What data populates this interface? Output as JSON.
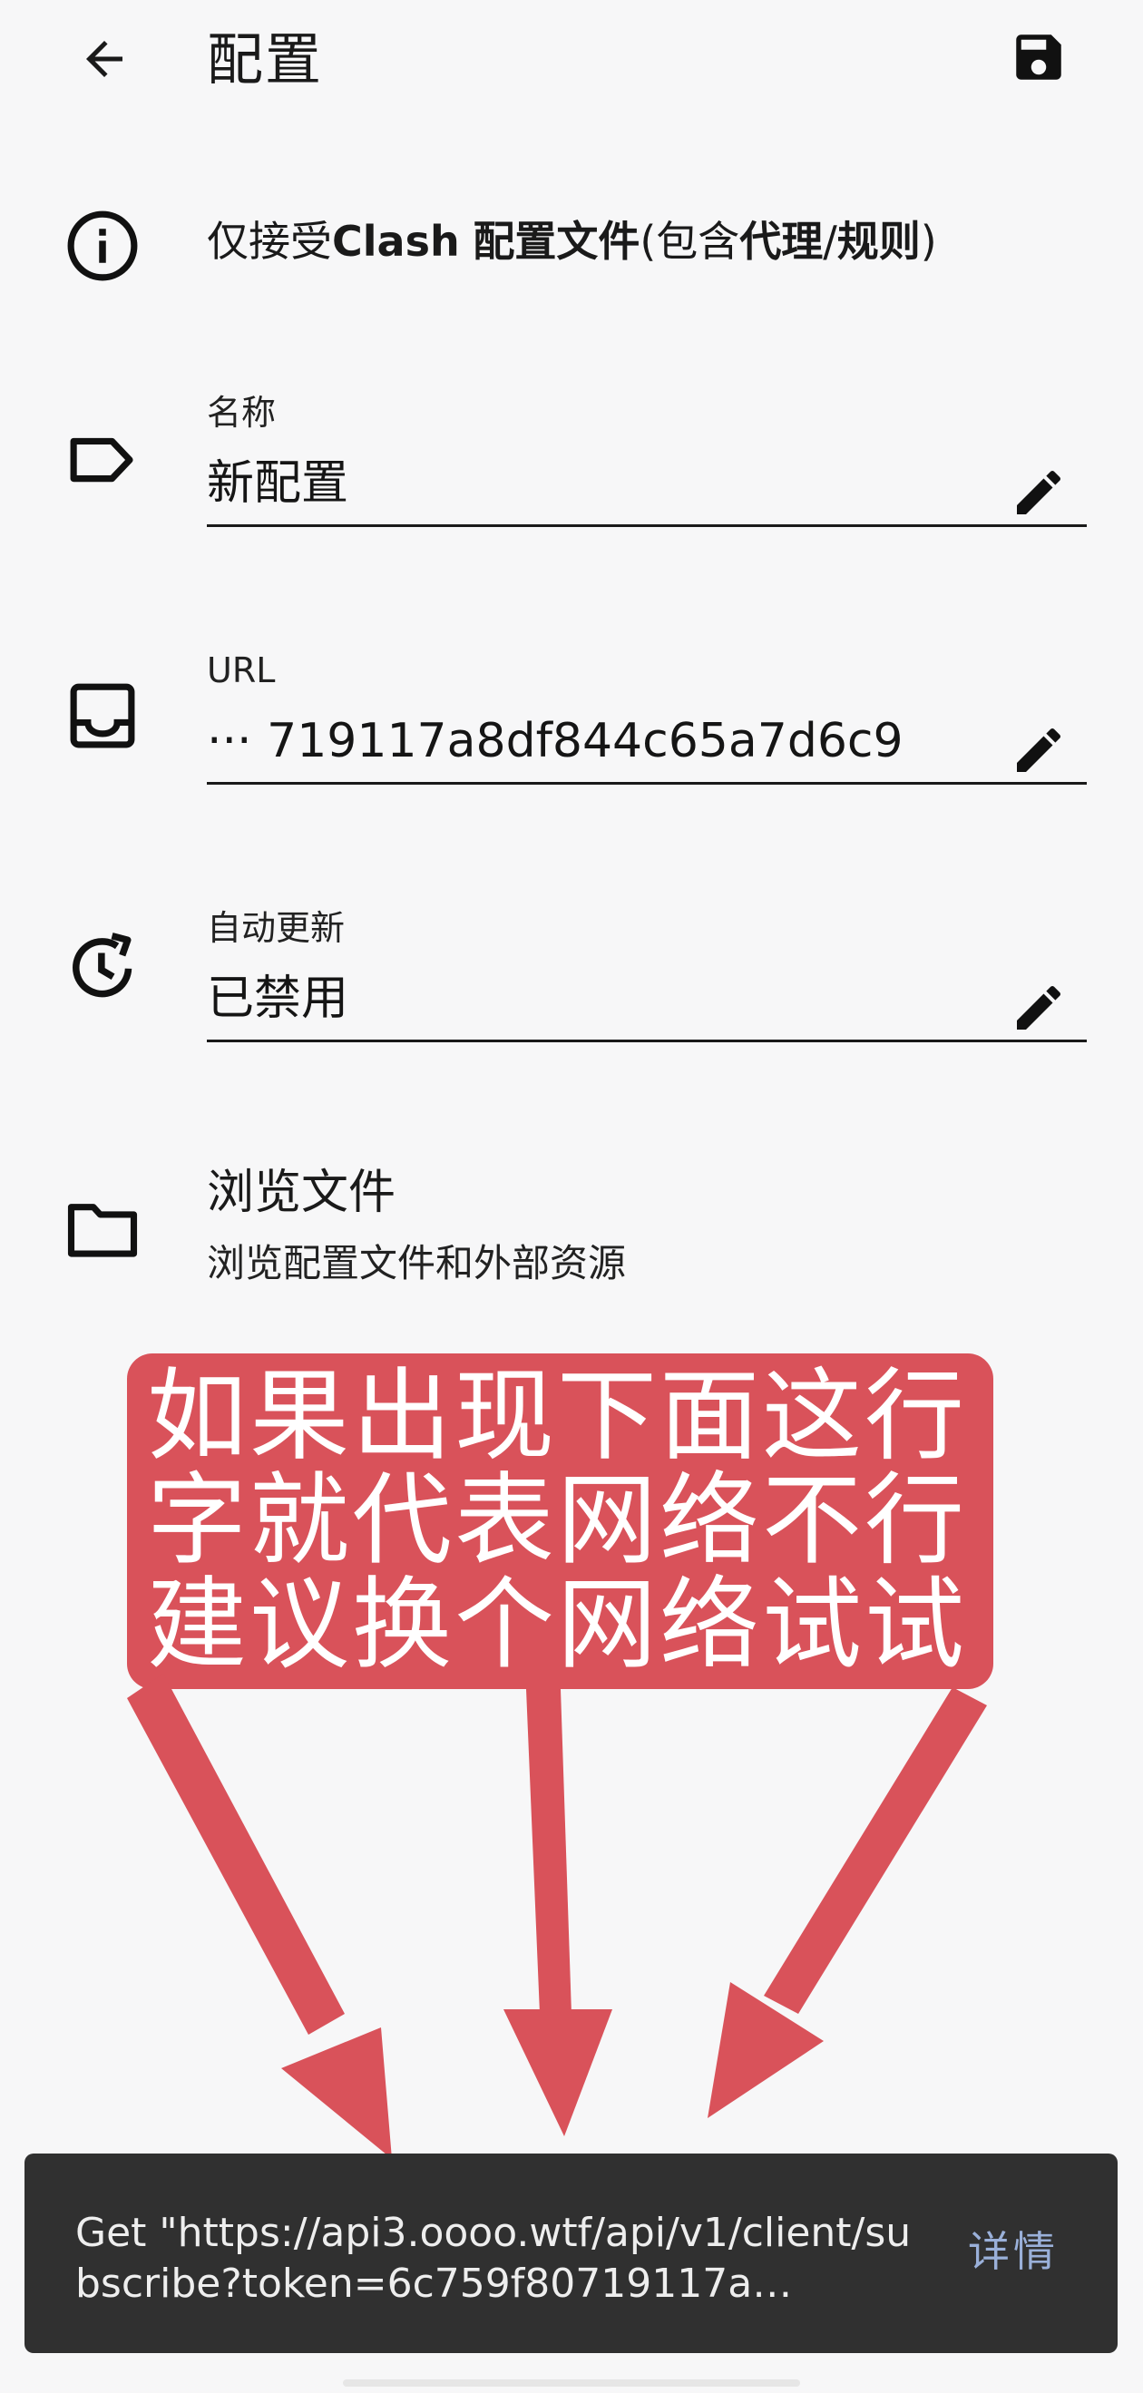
{
  "topbar": {
    "title": "配置",
    "back_icon": "arrow-back-icon",
    "save_icon": "save-icon"
  },
  "info": {
    "prefix": "仅接受",
    "bold1": "Clash",
    "space1": " ",
    "bold2": "配置文件",
    "paren_open": "(包含",
    "bold3": "代理",
    "slash": "/",
    "bold4": "规则",
    "paren_close": ")"
  },
  "fields": {
    "name": {
      "label": "名称",
      "value": "新配置"
    },
    "url": {
      "label": "URL",
      "value": "···         719117a8df844c65a7d6c9"
    },
    "auto_update": {
      "label": "自动更新",
      "value": "已禁用"
    }
  },
  "browse": {
    "title": "浏览文件",
    "subtitle": "浏览配置文件和外部资源"
  },
  "annotation": {
    "lines": [
      "如果出现下面这行",
      "字就代表网络不行",
      "建议换个网络试试"
    ],
    "color": "#d9525a"
  },
  "snackbar": {
    "message": "Get \"https://api3.oooo.wtf/api/v1/client/subscribe?token=6c759f80719117a…",
    "action": "详情"
  }
}
